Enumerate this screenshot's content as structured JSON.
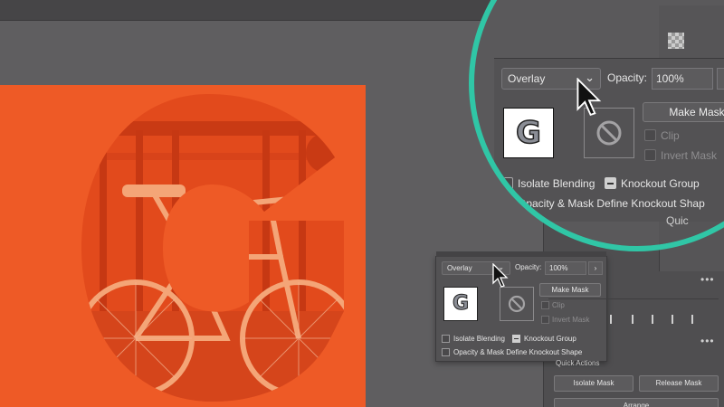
{
  "transparency_panel": {
    "blend_mode": "Overlay",
    "opacity_label": "Opacity:",
    "opacity_value": "100%",
    "make_mask_label": "Make Mask",
    "clip_label": "Clip",
    "invert_mask_label": "Invert Mask",
    "isolate_blending_label": "Isolate Blending",
    "knockout_group_label": "Knockout Group",
    "opacity_mask_knockout_label": "Opacity & Mask Define Knockout Shape",
    "opacity_mask_knockout_label_cropped": "Opacity & Mask Define Knockout Shap",
    "thumbnail_letter": "G"
  },
  "quick_actions": {
    "heading": "Quick Actions",
    "heading_cropped": "Quic",
    "isolate_mask_label": "Isolate Mask",
    "release_mask_label": "Release Mask",
    "arrange_label": "Arrange"
  },
  "colors": {
    "artboard": "#ee5a26",
    "zoom_ring": "#30c6a6",
    "panel_bg": "#535254"
  }
}
